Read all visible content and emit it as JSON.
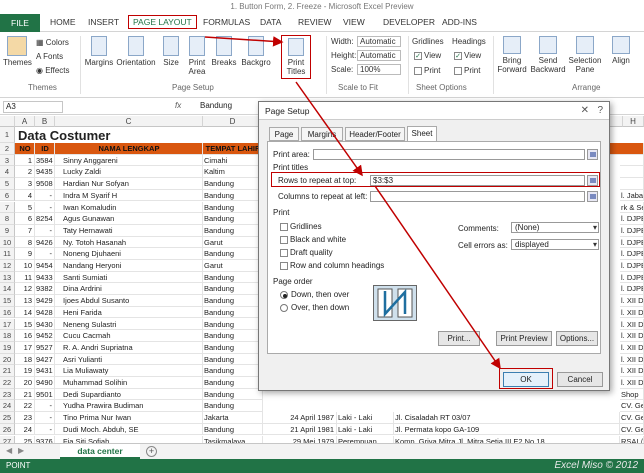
{
  "window": {
    "title": "1. Button Form, 2. Freeze - Microsoft Excel Preview"
  },
  "tabs": [
    "FILE",
    "HOME",
    "INSERT",
    "PAGE LAYOUT",
    "FORMULAS",
    "DATA",
    "REVIEW",
    "VIEW",
    "DEVELOPER",
    "ADD-INS"
  ],
  "ribbon": {
    "themes": {
      "themes": "Themes",
      "colors": "Colors",
      "fonts": "Fonts",
      "effects": "Effects",
      "group": "Themes"
    },
    "page_setup": {
      "margins": "Margins",
      "orientation": "Orientation",
      "size": "Size",
      "print_area": "Print Area",
      "breaks": "Breaks",
      "background": "Backgro",
      "print_titles": "Print Titles",
      "group": "Page Setup"
    },
    "scale": {
      "width_label": "Width:",
      "width_val": "Automatic",
      "height_label": "Height:",
      "height_val": "Automatic",
      "scale_label": "Scale:",
      "scale_val": "100%",
      "group": "Scale to Fit"
    },
    "sheet_options": {
      "gridlines": "Gridlines",
      "headings": "Headings",
      "view1": "View",
      "view2": "View",
      "print1": "Print",
      "print2": "Print",
      "group": "Sheet Options"
    },
    "arrange": {
      "bring": "Bring Forward",
      "send": "Send Backward",
      "selection": "Selection Pane",
      "align": "Align",
      "group": "Arrange"
    }
  },
  "formula_bar": {
    "namebox": "A3",
    "fx": "fx",
    "value": "Bandung"
  },
  "columns": [
    "A",
    "B",
    "C",
    "D",
    "H"
  ],
  "sheet": {
    "title": "Data Costumer",
    "headers": [
      "NO",
      "ID",
      "NAMA LENGKAP",
      "TEMPAT LAHIR"
    ],
    "row_numbers": [
      "1",
      "2",
      "3",
      "4",
      "5",
      "6",
      "7",
      "8",
      "9",
      "10",
      "11",
      "12",
      "13",
      "14",
      "15",
      "16",
      "17",
      "18",
      "19",
      "20",
      "21",
      "22",
      "23",
      "24",
      "25",
      "26",
      "27",
      "28"
    ],
    "rows": [
      {
        "no": "1",
        "id": "3584",
        "name": "Sinny Anggareni",
        "place": "Cimahi",
        "right": ""
      },
      {
        "no": "2",
        "id": "9435",
        "name": "Lucky Zaldi",
        "place": "Kaltim",
        "right": ""
      },
      {
        "no": "3",
        "id": "9508",
        "name": "Hardian Nur Sofyan",
        "place": "Bandung",
        "right": ""
      },
      {
        "no": "4",
        "id": "-",
        "name": "Indra M Syarif H",
        "place": "Bandung",
        "right": "l. Jabar S"
      },
      {
        "no": "5",
        "id": "-",
        "name": "Iwan Komaludin",
        "place": "Bandung",
        "right": "rk & Se"
      },
      {
        "no": "6",
        "id": "8254",
        "name": "Agus Gunawan",
        "place": "Bandung",
        "right": "l. DJPB"
      },
      {
        "no": "7",
        "id": "-",
        "name": "Taty Hernawati",
        "place": "Bandung",
        "right": "l. DJPB"
      },
      {
        "no": "8",
        "id": "9426",
        "name": "Ny. Totoh Hasanah",
        "place": "Garut",
        "right": "l. DJPB"
      },
      {
        "no": "9",
        "id": "-",
        "name": "Noneng Djuhaeni",
        "place": "Bandung",
        "right": "l. DJPB"
      },
      {
        "no": "10",
        "id": "9454",
        "name": "Nandang Heryoni",
        "place": "Garut",
        "right": "l. DJPB"
      },
      {
        "no": "11",
        "id": "9433",
        "name": "Santi Sumiati",
        "place": "Bandung",
        "right": "l. DJPB"
      },
      {
        "no": "12",
        "id": "9382",
        "name": "Dina Ardrini",
        "place": "Bandung",
        "right": "l. DJPB"
      },
      {
        "no": "13",
        "id": "9429",
        "name": "Ijoes Abdul Susanto",
        "place": "Bandung",
        "right": "l. XII DJ"
      },
      {
        "no": "14",
        "id": "9428",
        "name": "Heni Farida",
        "place": "Bandung",
        "right": "l. XII DJ"
      },
      {
        "no": "15",
        "id": "9430",
        "name": "Neneng Sulastri",
        "place": "Bandung",
        "right": "l. XII DJ"
      },
      {
        "no": "16",
        "id": "9452",
        "name": "Cucu Cacmah",
        "place": "Bandung",
        "right": "l. XII DJ"
      },
      {
        "no": "17",
        "id": "9527",
        "name": "R. A. Andri Supriatna",
        "place": "Bandung",
        "right": "l. XII DJ"
      },
      {
        "no": "18",
        "id": "9427",
        "name": "Asri Yulianti",
        "place": "Bandung",
        "right": "l. XII DJ"
      },
      {
        "no": "19",
        "id": "9431",
        "name": "Lia Muliawaty",
        "place": "Bandung",
        "right": "l. XII DJ"
      },
      {
        "no": "20",
        "id": "9490",
        "name": "Muhammad Solihin",
        "place": "Bandung",
        "right": "l. XII DJ"
      },
      {
        "no": "21",
        "id": "9501",
        "name": "Dedi Supardianto",
        "place": "Bandung",
        "right": "Shop"
      },
      {
        "no": "22",
        "id": "-",
        "name": "Yudha Prawira Budiman",
        "place": "Bandung",
        "right": "CV. Gerai Cip"
      },
      {
        "no": "23",
        "id": "-",
        "name": "Tino Prima Nur Iwan",
        "place": "Jakarta",
        "date": "24 April 1987",
        "sex": "Laki - Laki",
        "addr": "Jl. Cisaladah RT 03/07",
        "right": "CV. Gerai Cip"
      },
      {
        "no": "24",
        "id": "-",
        "name": "Dudi Moch. Abduh, SE",
        "place": "Bandung",
        "date": "21 April 1981",
        "sex": "Laki - Laki",
        "addr": "Jl. Permata kopo GA-109",
        "right": "CV. Gerai Cip"
      },
      {
        "no": "25",
        "id": "9376",
        "name": "Fia Siti Sofiah",
        "place": "Tasikmalaya",
        "date": "29 Mei 1979",
        "sex": "Perempuan",
        "addr": "Komp. Griya Mitra Jl. Mitra Setia III E2 No 18",
        "right": "RSAI / Rs. Al"
      },
      {
        "no": "26",
        "id": "9441",
        "name": "Anita Lestari",
        "place": "Bandung",
        "date": "20 Februari 1969",
        "sex": "Perempuan",
        "addr": "Jl. Gelap Nyawang No. 2",
        "right": "RSAI / Rs. Al"
      }
    ]
  },
  "sheet_tab": "data center",
  "status": "POINT",
  "watermark": "Excel Miso © 2012",
  "dialog": {
    "title": "Page Setup",
    "tabs": [
      "Page",
      "Margins",
      "Header/Footer",
      "Sheet"
    ],
    "print_area_label": "Print area:",
    "print_titles_label": "Print titles",
    "rows_repeat_label": "Rows to repeat at top:",
    "rows_repeat_value": "$3:$3",
    "cols_repeat_label": "Columns to repeat at left:",
    "cols_repeat_value": "",
    "print_label": "Print",
    "gridlines": "Gridlines",
    "black_white": "Black and white",
    "draft": "Draft quality",
    "row_col_headings": "Row and column headings",
    "comments_label": "Comments:",
    "comments_value": "(None)",
    "errors_label": "Cell errors as:",
    "errors_value": "displayed",
    "page_order_label": "Page order",
    "down_over": "Down, then over",
    "over_down": "Over, then down",
    "print_btn": "Print...",
    "preview_btn": "Print Preview",
    "options_btn": "Options...",
    "ok_btn": "OK",
    "cancel_btn": "Cancel"
  }
}
